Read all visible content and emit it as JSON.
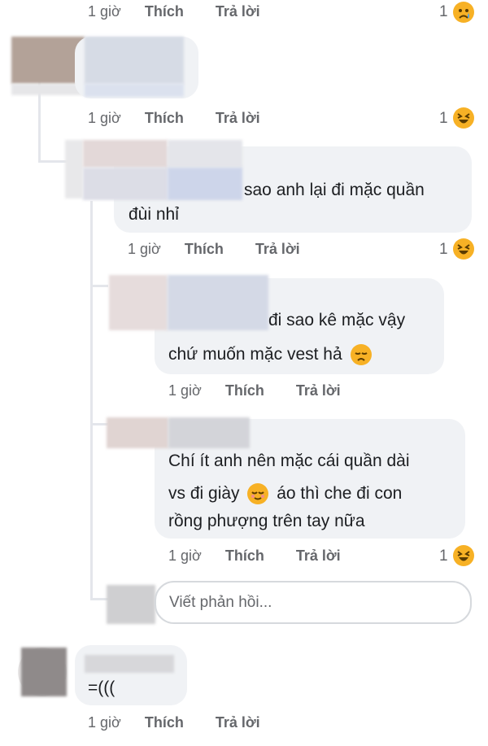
{
  "comments": [
    {
      "id": "c0",
      "meta": {
        "time": "1 giờ",
        "like": "Thích",
        "reply": "Trả lời"
      },
      "reaction": {
        "count": "1",
        "icon": "sad-emoji-icon"
      }
    },
    {
      "id": "c1",
      "meta": {
        "time": "1 giờ",
        "like": "Thích",
        "reply": "Trả lời"
      },
      "reaction": {
        "count": "1",
        "icon": "haha-emoji-icon"
      }
    },
    {
      "id": "r1",
      "text_line1": "sao anh lại đi mặc quần",
      "text_line2": "đùi nhỉ",
      "meta": {
        "time": "1 giờ",
        "like": "Thích",
        "reply": "Trả lời"
      },
      "reaction": {
        "count": "1",
        "icon": "haha-emoji-icon"
      }
    },
    {
      "id": "r2",
      "text_line1": "đi sao kê mặc vậy",
      "text_line2": "chứ muốn mặc vest hả",
      "meta": {
        "time": "1 giờ",
        "like": "Thích",
        "reply": "Trả lời"
      }
    },
    {
      "id": "r3",
      "text_line1": "Chí ít anh nên mặc cái quần dài",
      "text_line2a": "vs đi giày",
      "text_line2b": "áo thì che đi con",
      "text_line3": "rồng phượng trên tay nữa",
      "meta": {
        "time": "1 giờ",
        "like": "Thích",
        "reply": "Trả lời"
      },
      "reaction": {
        "count": "1",
        "icon": "haha-emoji-icon"
      }
    },
    {
      "id": "c2",
      "text": "=(((",
      "meta": {
        "time": "1 giờ",
        "like": "Thích",
        "reply": "Trả lời"
      }
    }
  ],
  "reply_box": {
    "placeholder": "Viết phản hồi..."
  },
  "colors": {
    "bubble": "#f0f2f5",
    "meta": "#65676b",
    "text": "#1c1e21",
    "emoji": "#f7b125"
  }
}
